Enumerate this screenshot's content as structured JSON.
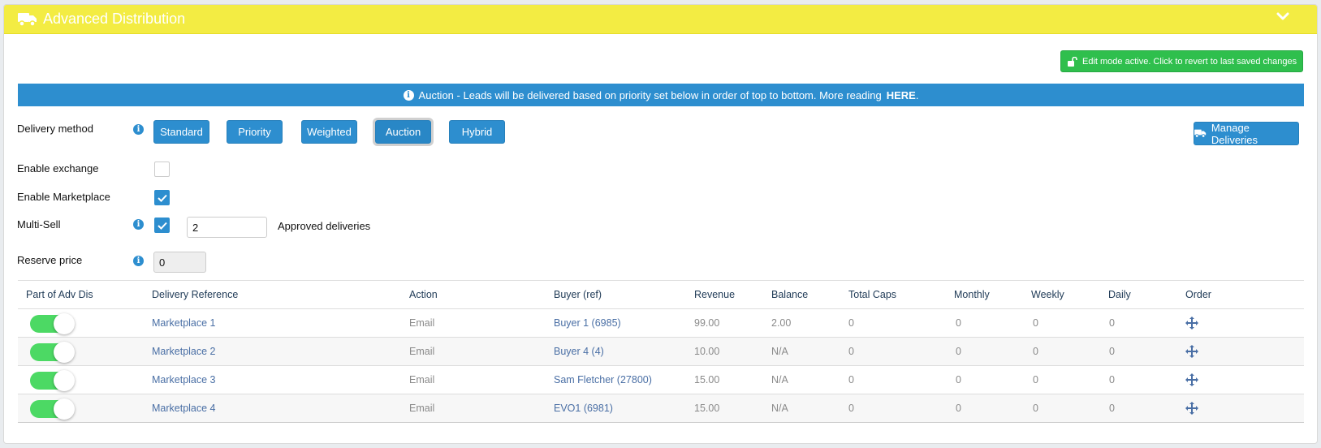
{
  "header": {
    "title": "Advanced Distribution"
  },
  "edit_button": {
    "label": "Edit mode active. Click to revert to last saved changes"
  },
  "info_bar": {
    "text": "Auction - Leads will be delivered based on priority set below in order of top to bottom. More reading",
    "link": "HERE",
    "suffix": "."
  },
  "delivery_method": {
    "label": "Delivery method",
    "options": [
      "Standard",
      "Priority",
      "Weighted",
      "Auction",
      "Hybrid"
    ],
    "selected": "Auction"
  },
  "manage_button": {
    "label": "Manage Deliveries"
  },
  "settings": {
    "enable_exchange": {
      "label": "Enable exchange",
      "checked": false
    },
    "enable_marketplace": {
      "label": "Enable Marketplace",
      "checked": true
    },
    "multi_sell": {
      "label": "Multi-Sell",
      "checked": true,
      "value": "2",
      "suffix": "Approved deliveries"
    },
    "reserve_price": {
      "label": "Reserve price",
      "value": "0"
    }
  },
  "table": {
    "columns": [
      "Part of Adv Dis",
      "Delivery Reference",
      "Action",
      "Buyer (ref)",
      "Revenue",
      "Balance",
      "Total Caps",
      "Monthly",
      "Weekly",
      "Daily",
      "Order"
    ],
    "rows": [
      {
        "enabled": true,
        "reference": "Marketplace 1",
        "action": "Email",
        "buyer": "Buyer 1 (6985)",
        "revenue": "99.00",
        "balance": "2.00",
        "total_caps": "0",
        "monthly": "0",
        "weekly": "0",
        "daily": "0"
      },
      {
        "enabled": true,
        "reference": "Marketplace 2",
        "action": "Email",
        "buyer": "Buyer 4 (4)",
        "revenue": "10.00",
        "balance": "N/A",
        "total_caps": "0",
        "monthly": "0",
        "weekly": "0",
        "daily": "0"
      },
      {
        "enabled": true,
        "reference": "Marketplace 3",
        "action": "Email",
        "buyer": "Sam Fletcher (27800)",
        "revenue": "15.00",
        "balance": "N/A",
        "total_caps": "0",
        "monthly": "0",
        "weekly": "0",
        "daily": "0"
      },
      {
        "enabled": true,
        "reference": "Marketplace 4",
        "action": "Email",
        "buyer": "EVO1 (6981)",
        "revenue": "15.00",
        "balance": "N/A",
        "total_caps": "0",
        "monthly": "0",
        "weekly": "0",
        "daily": "0"
      }
    ]
  },
  "icons": {
    "header": "truck-icon",
    "collapse": "chevron-down-icon",
    "edit": "unlock-icon",
    "info": "info-icon",
    "manage": "truck-icon",
    "order": "move-icon"
  },
  "colors": {
    "header": "#f3ec43",
    "primary": "#2d8ecf",
    "success": "#2fbf4d",
    "toggle_on": "#4cd964"
  }
}
